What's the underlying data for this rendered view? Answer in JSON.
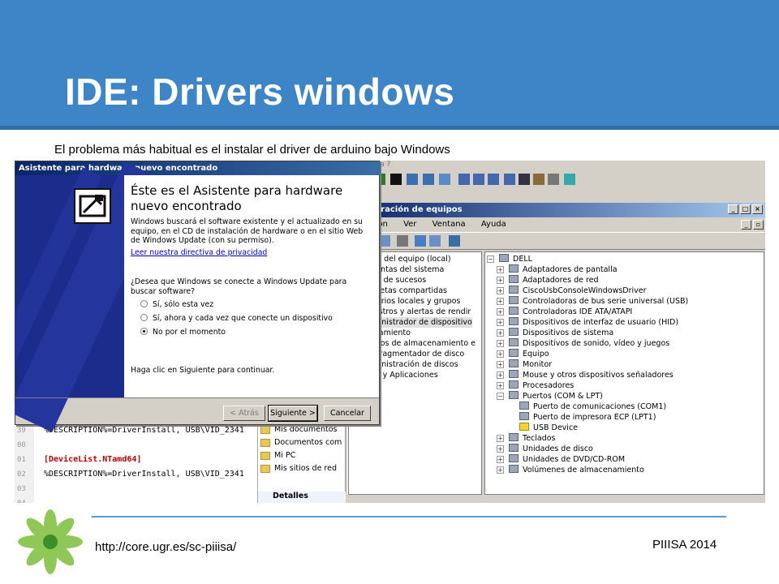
{
  "slide": {
    "title": "IDE: Drivers windows",
    "intro": "El problema más habitual es el instalar el driver de arduino bajo Windows",
    "footer_url": "http://core.ugr.es/sc-piiisa/",
    "footer_right": "PIIISA 2014"
  },
  "colors": {
    "banner": "#3d85c6",
    "rule": "#5b9bd5"
  },
  "wizard": {
    "title": "Asistente para hardware nuevo encontrado",
    "heading": "Éste es el Asistente para hardware nuevo encontrado",
    "description": "Windows buscará el software existente y el actualizado en su equipo, en el CD de instalación de hardware o en el sitio Web de Windows Update (con su permiso).",
    "privacy_link": "Leer nuestra directiva de privacidad",
    "question": "¿Desea que Windows se conecte a Windows Update para buscar software?",
    "options": [
      {
        "label": "Sí, sólo esta vez",
        "selected": false
      },
      {
        "label": "Sí, ahora y cada vez que conecte un dispositivo",
        "selected": false
      },
      {
        "label": "No por el momento",
        "selected": true
      }
    ],
    "continue_text": "Haga clic en Siguiente para continuar.",
    "back_label": "< Atrás",
    "next_label": "Siguiente >",
    "cancel_label": "Cancelar"
  },
  "editor": {
    "line_numbers": [
      "39",
      "00",
      "01",
      "02",
      "03",
      "04"
    ],
    "lines": [
      "%DESCRIPTION%=DriverInstall, USB\\VID_2341",
      "",
      "[DeviceList.NTamd64]",
      "%DESCRIPTION%=DriverInstall, USB\\VID_2341",
      "",
      ""
    ]
  },
  "folder_pane": {
    "items": [
      "Mis documentos",
      "Documentos com",
      "Mi PC",
      "Mis sitios de red"
    ],
    "details_label": "Detalles"
  },
  "mmc": {
    "top_menu_fragment": "ana  ?",
    "title": "istración de equipos",
    "menu": [
      "Acción",
      "Ver",
      "Ventana",
      "Ayuda"
    ],
    "left_tree": [
      "stración del equipo (local)",
      "erramientas del sistema",
      "Visor de sucesos",
      "Carpetas compartidas",
      "Usuarios locales y grupos",
      "Registros y alertas de rendir",
      "Administrador de dispositivo",
      "lmacenamiento",
      "Medios de almacenamiento e",
      "Desfragmentador de disco",
      "Administración de discos",
      "ervicios y Aplicaciones"
    ],
    "device_tree": {
      "root": "DELL",
      "categories": [
        "Adaptadores de pantalla",
        "Adaptadores de red",
        "CiscoUsbConsoleWindowsDriver",
        "Controladoras de bus serie universal (USB)",
        "Controladoras IDE ATA/ATAPI",
        "Dispositivos de interfaz de usuario (HID)",
        "Dispositivos de sistema",
        "Dispositivos de sonido, vídeo y juegos",
        "Equipo",
        "Monitor",
        "Mouse y otros dispositivos señaladores",
        "Procesadores",
        "Puertos (COM & LPT)"
      ],
      "ports_children": [
        "Puerto de comunicaciones (COM1)",
        "Puerto de impresora ECP (LPT1)",
        "USB Device"
      ],
      "categories_after": [
        "Teclados",
        "Unidades de disco",
        "Unidades de DVD/CD-ROM",
        "Volúmenes de almacenamiento"
      ]
    }
  }
}
